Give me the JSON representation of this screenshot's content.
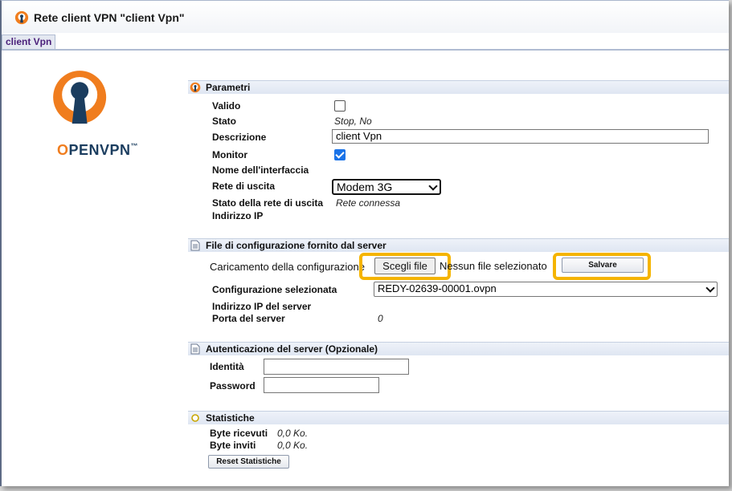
{
  "window": {
    "title": "Rete client VPN \"client Vpn\""
  },
  "tab": {
    "label": "client Vpn"
  },
  "logo": {
    "wordmark_o": "O",
    "wordmark_rest": "PENVPN",
    "wordmark_tm": "™"
  },
  "parametri": {
    "header": "Parametri",
    "valido_label": "Valido",
    "stato_label": "Stato",
    "stato_value": "Stop, No",
    "descrizione_label": "Descrizione",
    "descrizione_value": "client Vpn",
    "monitor_label": "Monitor",
    "interfaccia_label": "Nome dell'interfaccia",
    "rete_uscita_label": "Rete di uscita",
    "rete_uscita_value": "Modem 3G",
    "stato_rete_label": "Stato della rete di uscita",
    "stato_rete_value": "Rete connessa",
    "indirizzo_ip_label": "Indirizzo IP"
  },
  "config": {
    "header": "File di configurazione fornito dal server",
    "caricamento_label": "Caricamento della configurazione",
    "choose_file_label": "Scegli file",
    "no_file_text": "Nessun file selezionato",
    "save_label": "Salvare",
    "selezionata_label": "Configurazione selezionata",
    "selezionata_value": "REDY-02639-00001.ovpn",
    "server_ip_label": "Indirizzo IP del server",
    "porta_label": "Porta del server",
    "porta_value": "0"
  },
  "auth": {
    "header": "Autenticazione del server (Opzionale)",
    "identita_label": "Identità",
    "password_label": "Password"
  },
  "stats": {
    "header": "Statistiche",
    "ricevuti_label": "Byte ricevuti",
    "ricevuti_value": "0,0 Ko.",
    "inviti_label": "Byte inviti",
    "inviti_value": "0,0 Ko.",
    "reset_label": "Reset Statistiche"
  },
  "colors": {
    "accent_highlight": "#f5b400",
    "openvpn_orange": "#f07d1e",
    "openvpn_navy": "#1b3d5f",
    "checkbox_on": "#1a73e8"
  }
}
